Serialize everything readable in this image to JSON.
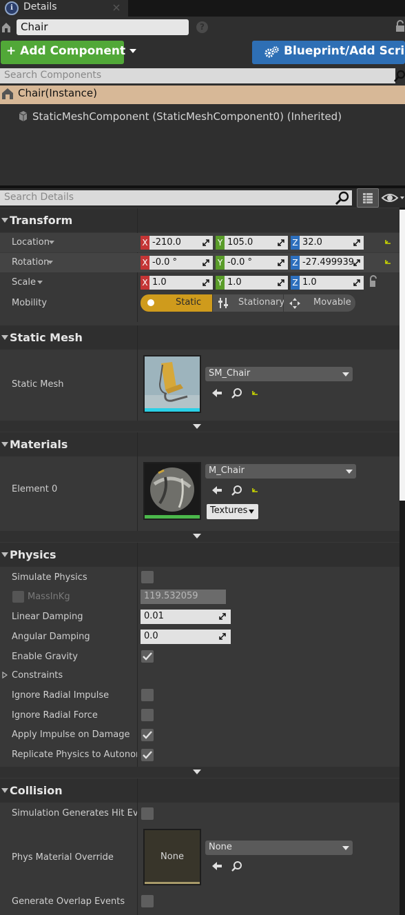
{
  "tab": {
    "title": "Details",
    "icon": "magnifier-icon"
  },
  "actor": {
    "name": "Chair"
  },
  "toolbar": {
    "add_component": "Add Component",
    "blueprint": "Blueprint/Add Script"
  },
  "components": {
    "search_placeholder": "Search Components",
    "instance_label": "Chair(Instance)",
    "items": [
      {
        "label": "StaticMeshComponent (StaticMeshComponent0) (Inherited)"
      }
    ]
  },
  "details": {
    "search_placeholder": "Search Details"
  },
  "transform": {
    "title": "Transform",
    "location": {
      "label": "Location",
      "x": "-210.0",
      "y": "105.0",
      "z": "32.0"
    },
    "rotation": {
      "label": "Rotation",
      "x": "-0.0 °",
      "y": "-0.0 °",
      "z": "-27.499939"
    },
    "scale": {
      "label": "Scale",
      "x": "1.0",
      "y": "1.0",
      "z": "1.0"
    },
    "mobility": {
      "label": "Mobility",
      "options": [
        "Static",
        "Stationary",
        "Movable"
      ],
      "selected": "Static"
    }
  },
  "axis_labels": {
    "x": "X",
    "y": "Y",
    "z": "Z"
  },
  "static_mesh": {
    "title": "Static Mesh",
    "label": "Static Mesh",
    "value": "SM_Chair"
  },
  "materials": {
    "title": "Materials",
    "element_label": "Element 0",
    "value": "M_Chair",
    "textures_label": "Textures"
  },
  "physics": {
    "title": "Physics",
    "simulate_physics": {
      "label": "Simulate Physics",
      "checked": false
    },
    "mass": {
      "label": "MassInKg",
      "value": "119.532059"
    },
    "linear_damping": {
      "label": "Linear Damping",
      "value": "0.01"
    },
    "angular_damping": {
      "label": "Angular Damping",
      "value": "0.0"
    },
    "enable_gravity": {
      "label": "Enable Gravity",
      "checked": true
    },
    "constraints": {
      "label": "Constraints"
    },
    "ignore_radial_impulse": {
      "label": "Ignore Radial Impulse",
      "checked": false
    },
    "ignore_radial_force": {
      "label": "Ignore Radial Force",
      "checked": false
    },
    "apply_impulse": {
      "label": "Apply Impulse on Damage",
      "checked": true
    },
    "replicate": {
      "label": "Replicate Physics to Autonomou",
      "checked": true
    }
  },
  "collision": {
    "title": "Collision",
    "sim_hit_events": {
      "label": "Simulation Generates Hit Events",
      "checked": false
    },
    "phys_material": {
      "label": "Phys Material Override",
      "thumb_text": "None",
      "value": "None"
    },
    "overlap_events": {
      "label": "Generate Overlap Events",
      "checked": false
    }
  },
  "colors": {
    "add_button": "#51a838",
    "blueprint_button": "#2e6fb5",
    "instance_row": "#d7b897",
    "static_selected": "#cf9b1c",
    "axis_x": "#c43535",
    "axis_y": "#5a9c2a",
    "axis_z": "#2d6fbd"
  }
}
